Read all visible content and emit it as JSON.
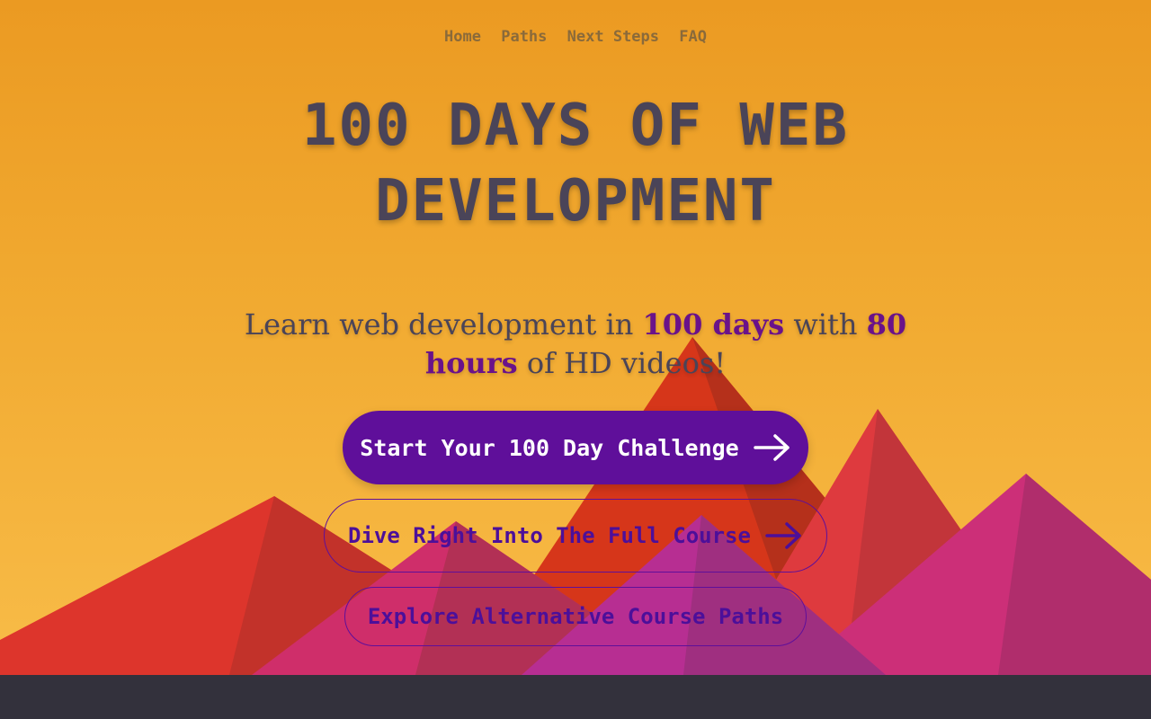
{
  "nav": {
    "items": [
      {
        "label": "Home"
      },
      {
        "label": "Paths"
      },
      {
        "label": "Next Steps"
      },
      {
        "label": "FAQ"
      }
    ]
  },
  "hero": {
    "title_line1": "100 DAYS OF WEB",
    "title_line2": "DEVELOPMENT",
    "subtitle": {
      "part1": "Learn web development in ",
      "days": "100 days",
      "part2": " with ",
      "hours": "80 hours",
      "part3": " of HD videos!"
    }
  },
  "buttons": {
    "start_label": "Start Your 100 Day Challenge",
    "course_label": "Dive Right Into The Full Course",
    "paths_label": "Explore Alternative Course Paths"
  },
  "icons": {
    "start_arrow": "arrow-right-icon",
    "course_arrow": "arrow-right-icon"
  },
  "colors": {
    "accent": "#5f0f9a",
    "title_text": "#4a4458",
    "background_top": "#eb9a22",
    "background_bottom": "#f8bc48",
    "footer": "#33313c"
  }
}
